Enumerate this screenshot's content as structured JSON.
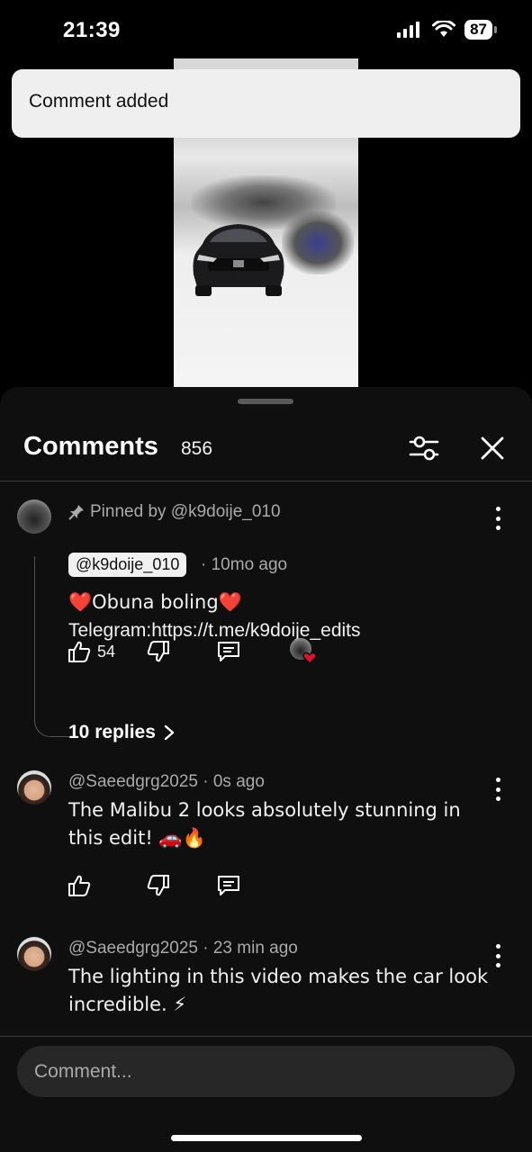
{
  "status": {
    "time": "21:39",
    "battery": "87"
  },
  "toast": {
    "text": "Comment added"
  },
  "sheet": {
    "title": "Comments",
    "count": "856"
  },
  "comments": [
    {
      "pinned_label": "Pinned by @k9doije_010",
      "author": "@k9doije_010",
      "time": "10mo ago",
      "line1": "❤️Obuna boling❤️",
      "line2": "Telegram:https://t.me/k9doije_edits",
      "likes": "54",
      "replies_label": "10 replies"
    },
    {
      "author": "@Saeedgrg2025",
      "time": "0s ago",
      "text": "The Malibu 2 looks absolutely stunning in this edit! 🚗🔥"
    },
    {
      "author": "@Saeedgrg2025",
      "time": "23 min ago",
      "text": "The lighting in this video makes the car look incredible. ⚡"
    }
  ],
  "input": {
    "placeholder": "Comment..."
  },
  "colors": {
    "sheet_bg": "#0f0f0f",
    "toast_bg": "#efefef",
    "heart": "#e0102a"
  }
}
